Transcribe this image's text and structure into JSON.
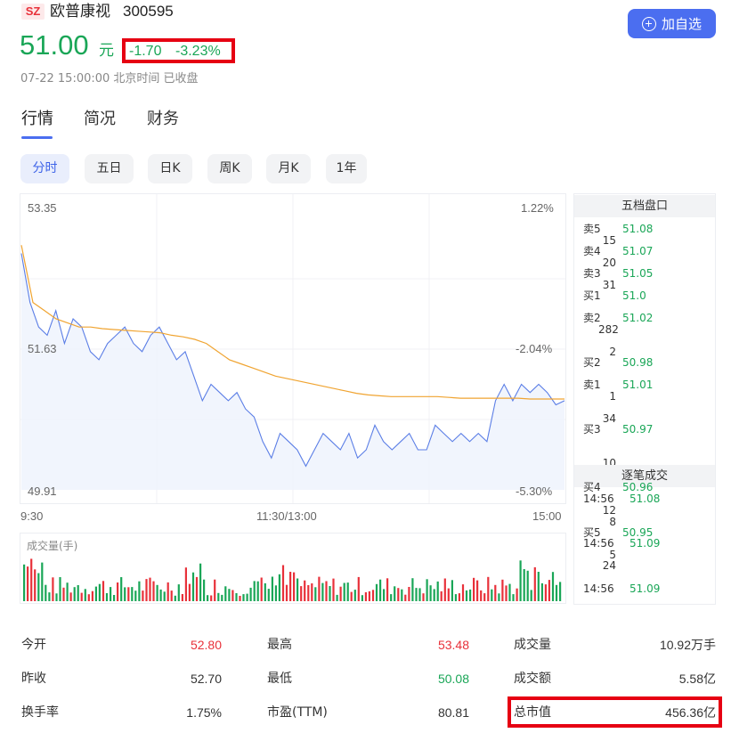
{
  "stock": {
    "exchange": "SZ",
    "name": "欧普康视",
    "code": "300595",
    "price": "51.00",
    "unit": "元",
    "change": "-1.70",
    "change_pct": "-3.23%",
    "status": "07-22 15:00:00 北京时间 已收盘",
    "add_button": "加自选",
    "colors": {
      "up": "#e8313a",
      "down": "#1aa657",
      "accent": "#4b6ef0",
      "highlight_box": "#e60012"
    }
  },
  "main_tabs": [
    {
      "label": "行情",
      "active": true
    },
    {
      "label": "简况",
      "active": false
    },
    {
      "label": "财务",
      "active": false
    }
  ],
  "period_tabs": [
    {
      "label": "分时",
      "active": true
    },
    {
      "label": "五日",
      "active": false
    },
    {
      "label": "日K",
      "active": false
    },
    {
      "label": "周K",
      "active": false
    },
    {
      "label": "月K",
      "active": false
    },
    {
      "label": "1年",
      "active": false
    }
  ],
  "chart": {
    "y_left": [
      "53.35",
      "51.63",
      "49.91"
    ],
    "y_right": [
      "1.22%",
      "-2.04%",
      "-5.30%"
    ],
    "x_labels": [
      "9:30",
      "11:30/13:00",
      "15:00"
    ],
    "volume_label": "成交量(手)"
  },
  "chart_data": {
    "type": "line",
    "title": "",
    "xlabel": "",
    "ylabel": "",
    "ylim": [
      49.91,
      53.35
    ],
    "x_ticks": [
      "9:30",
      "11:30/13:00",
      "15:00"
    ],
    "grid": true,
    "series": [
      {
        "values": [
          52.8,
          52.2,
          51.9,
          51.8,
          52.1,
          51.7,
          52.0,
          51.9,
          51.6,
          51.5,
          51.7,
          51.8,
          51.9,
          51.7,
          51.6,
          51.8,
          51.9,
          51.7,
          51.5,
          51.6,
          51.3,
          51.0,
          51.2,
          51.1,
          51.0,
          51.1,
          50.9,
          50.8,
          50.5,
          50.3,
          50.6,
          50.5,
          50.4,
          50.2,
          50.4,
          50.6,
          50.5,
          50.4,
          50.6,
          50.3,
          50.4,
          50.7,
          50.5,
          50.4,
          50.5,
          50.6,
          50.4,
          50.4,
          50.7,
          50.6,
          50.5,
          50.6,
          50.5,
          50.6,
          50.5,
          51.0,
          51.2,
          51.0,
          51.2,
          51.1,
          51.2,
          51.1,
          50.95,
          51.0
        ]
      },
      {
        "values": [
          52.9,
          52.2,
          52.1,
          52.0,
          51.95,
          51.9,
          51.9,
          51.88,
          51.87,
          51.86,
          51.85,
          51.84,
          51.83,
          51.8,
          51.78,
          51.75,
          51.7,
          51.6,
          51.5,
          51.45,
          51.4,
          51.35,
          51.3,
          51.27,
          51.24,
          51.21,
          51.18,
          51.15,
          51.12,
          51.09,
          51.07,
          51.06,
          51.05,
          51.05,
          51.05,
          51.05,
          51.05,
          51.04,
          51.03,
          51.03,
          51.03,
          51.03,
          51.03,
          51.03,
          51.02,
          51.02,
          51.02,
          51.02
        ]
      }
    ]
  },
  "order_book": {
    "title": "五档盘口",
    "rows": [
      {
        "label": "卖5",
        "price": "51.08",
        "volume": "15"
      },
      {
        "label": "卖4",
        "price": "51.07",
        "volume": "20"
      },
      {
        "label": "卖3",
        "price": "51.05",
        "volume": "31"
      },
      {
        "label": "买1",
        "price": "51.0",
        "volume": ""
      },
      {
        "label": "卖2",
        "price": "51.02",
        "volume": "282"
      },
      {
        "label": "",
        "price": "",
        "volume": "2"
      },
      {
        "label": "买2",
        "price": "50.98",
        "volume": ""
      },
      {
        "label": "卖1",
        "price": "51.01",
        "volume": "1"
      },
      {
        "label": "",
        "price": "",
        "volume": "34"
      },
      {
        "label": "买3",
        "price": "50.97",
        "volume": ""
      },
      {
        "label": "",
        "price": "",
        "volume": "10"
      }
    ]
  },
  "trades": {
    "title": "逐笔成交",
    "rows": [
      {
        "label": "买4",
        "price": "50.96"
      },
      {
        "label": "14:56",
        "price": "51.08"
      },
      {
        "label": "",
        "price": "12"
      },
      {
        "label": "",
        "price": "8"
      },
      {
        "label": "买5",
        "price": "50.95"
      },
      {
        "label": "14:56",
        "price": "51.09"
      },
      {
        "label": "",
        "price": "5"
      },
      {
        "label": "",
        "price": "24"
      },
      {
        "label": "14:56",
        "price": "51.09"
      }
    ]
  },
  "stats": [
    {
      "label": "今开",
      "value": "52.80",
      "color": "#e8313a"
    },
    {
      "label": "最高",
      "value": "53.48",
      "color": "#e8313a"
    },
    {
      "label": "成交量",
      "value": "10.92万手",
      "color": "#333333"
    },
    {
      "label": "昨收",
      "value": "52.70",
      "color": "#333333"
    },
    {
      "label": "最低",
      "value": "50.08",
      "color": "#1aa657"
    },
    {
      "label": "成交额",
      "value": "5.58亿",
      "color": "#333333"
    },
    {
      "label": "换手率",
      "value": "1.75%",
      "color": "#333333"
    },
    {
      "label": "市盈(TTM)",
      "value": "80.81",
      "color": "#333333"
    },
    {
      "label": "总市值",
      "value": "456.36亿",
      "color": "#333333"
    }
  ]
}
